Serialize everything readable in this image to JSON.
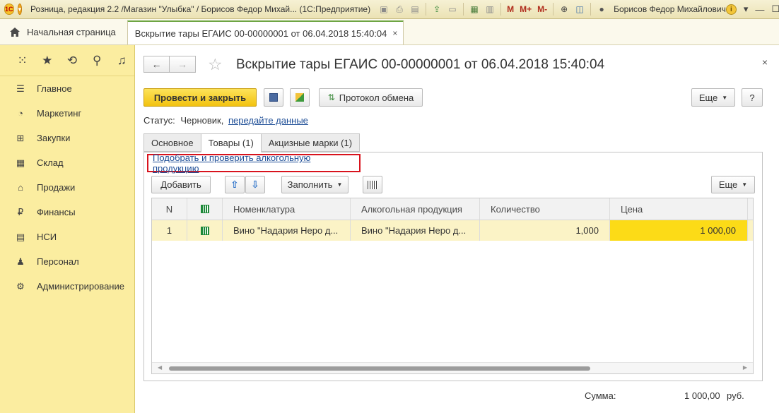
{
  "titlebar": {
    "logo": "1С",
    "title": "Розница, редакция 2.2 /Магазин \"Улыбка\" / Борисов Федор Михай... (1С:Предприятие)",
    "m": "M",
    "m_plus": "M+",
    "m_minus": "M-",
    "user": "Борисов Федор Михайлович",
    "info": "i"
  },
  "tabs_bar": {
    "home": "Начальная страница",
    "doc_tab": "Вскрытие тары ЕГАИС 00-00000001 от 06.04.2018 15:40:04",
    "close": "×"
  },
  "sidebar": {
    "items": [
      {
        "label": "Главное",
        "icon": "menu-icon"
      },
      {
        "label": "Маркетинг",
        "icon": "pie-chart-icon"
      },
      {
        "label": "Закупки",
        "icon": "cart-icon"
      },
      {
        "label": "Склад",
        "icon": "warehouse-icon"
      },
      {
        "label": "Продажи",
        "icon": "basket-icon"
      },
      {
        "label": "Финансы",
        "icon": "ruble-icon"
      },
      {
        "label": "НСИ",
        "icon": "list-icon"
      },
      {
        "label": "Персонал",
        "icon": "person-icon"
      },
      {
        "label": "Администрирование",
        "icon": "gear-icon"
      }
    ]
  },
  "document": {
    "title": "Вскрытие тары ЕГАИС 00-00000001 от 06.04.2018 15:40:04",
    "close": "×",
    "post_and_close": "Провести и закрыть",
    "exchange_log": "Протокол обмена",
    "more": "Еще",
    "help": "?",
    "status_label": "Статус:",
    "status_value": "Черновик,",
    "status_link": "передайте данные",
    "tabs": [
      "Основное",
      "Товары (1)",
      "Акцизные марки (1)"
    ],
    "pick_link": "Подобрать и проверить алкогольную продукцию",
    "add": "Добавить",
    "fill": "Заполнить",
    "table_more": "Еще"
  },
  "table": {
    "headers": {
      "n": "N",
      "nomenclature": "Номенклатура",
      "alcohol": "Алкогольная продукция",
      "qty": "Количество",
      "price": "Цена"
    },
    "rows": [
      {
        "n": "1",
        "nomenclature": "Вино \"Надария Неро д...",
        "alcohol": "Вино \"Надария Неро д...",
        "qty": "1,000",
        "price": "1 000,00"
      }
    ]
  },
  "footer": {
    "sum_label": "Сумма:",
    "sum_value": "1 000,00",
    "currency": "руб."
  }
}
